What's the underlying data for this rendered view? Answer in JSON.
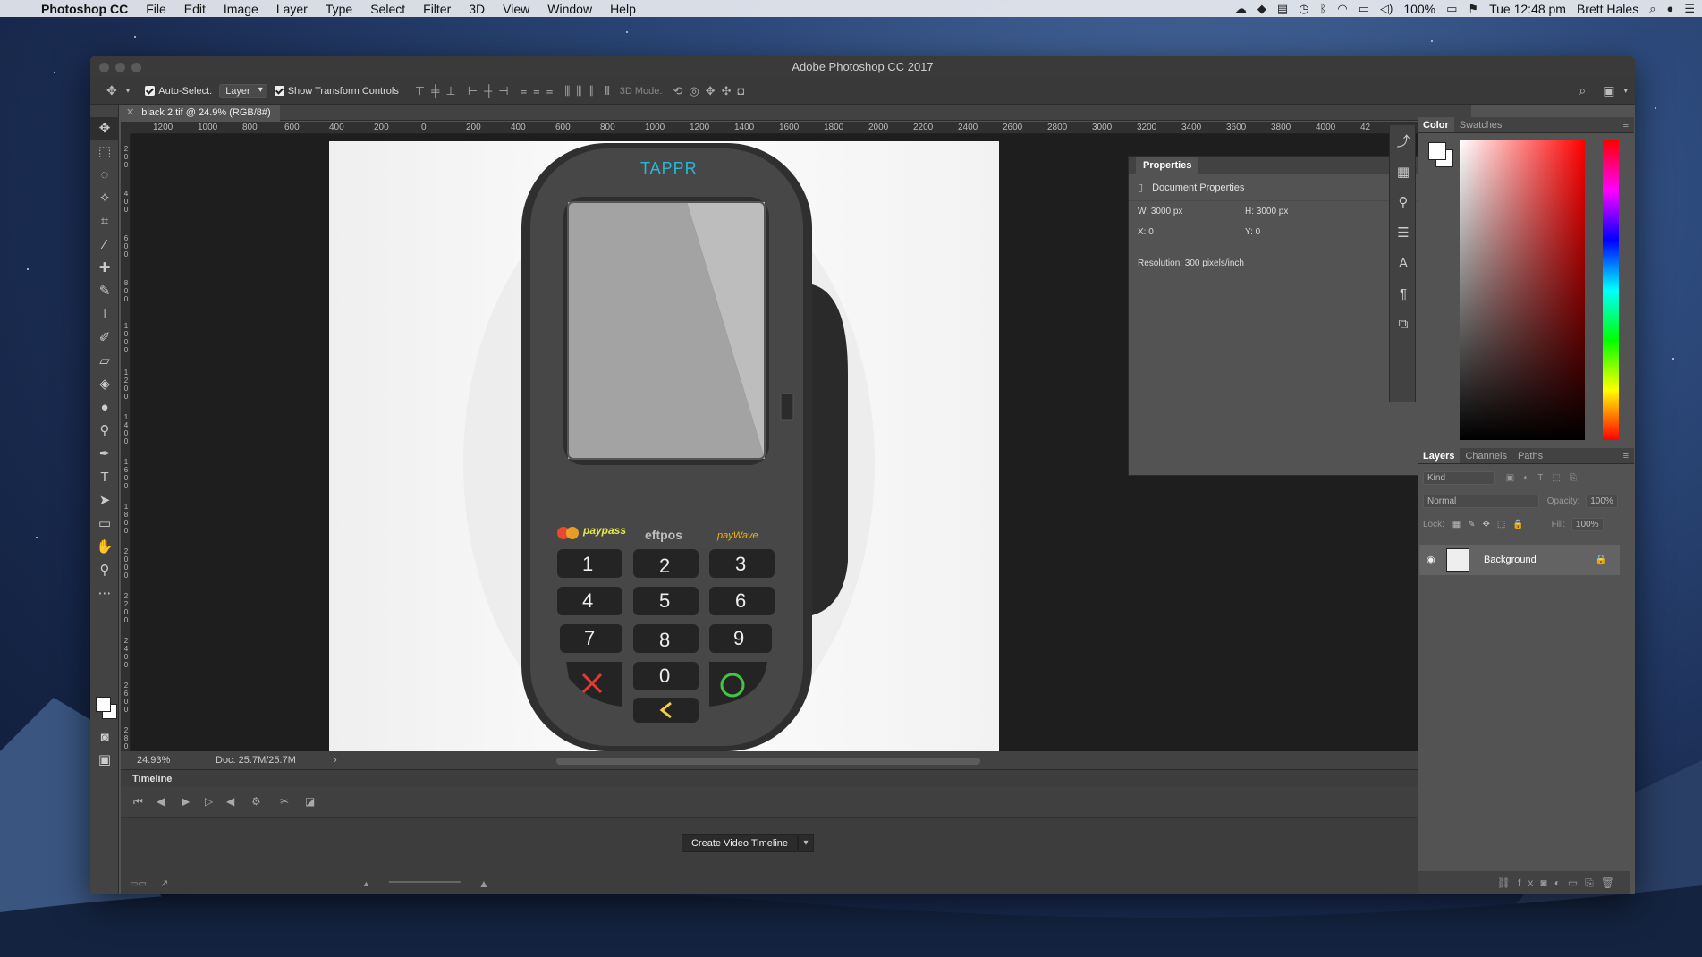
{
  "menubar": {
    "app_name": "Photoshop CC",
    "items": [
      "File",
      "Edit",
      "Image",
      "Layer",
      "Type",
      "Select",
      "Filter",
      "3D",
      "View",
      "Window",
      "Help"
    ],
    "battery": "100%",
    "clock": "Tue 12:48 pm",
    "user": "Brett Hales"
  },
  "window": {
    "title": "Adobe Photoshop CC 2017"
  },
  "options_bar": {
    "auto_select_label": "Auto-Select:",
    "auto_select_value": "Layer",
    "transform_label": "Show Transform Controls",
    "mode_label": "3D Mode:"
  },
  "doc_tab": {
    "title": "black 2.tif @ 24.9% (RGB/8#)"
  },
  "rulers": {
    "h_ticks": [
      "1200",
      "1000",
      "800",
      "600",
      "400",
      "200",
      "0",
      "200",
      "400",
      "600",
      "800",
      "1000",
      "1200",
      "1400",
      "1600",
      "1800",
      "2000",
      "2200",
      "2400",
      "2600",
      "2800",
      "3000",
      "3200",
      "3400",
      "3600",
      "3800",
      "4000",
      "42"
    ],
    "v_ticks": [
      "200",
      "400",
      "600",
      "800",
      "1000",
      "1200",
      "1400",
      "1600",
      "1800",
      "2000",
      "2200",
      "2400",
      "2600",
      "2800",
      "2"
    ]
  },
  "device": {
    "brand": "TAPPR",
    "paypass_label": "paypass",
    "eftpos_label": "eftpos",
    "paywave_label": "payWave",
    "keys": [
      "1",
      "2",
      "3",
      "4",
      "5",
      "6",
      "7",
      "8",
      "9",
      "0"
    ]
  },
  "status": {
    "zoom": "24.93%",
    "doc_size": "Doc: 25.7M/25.7M"
  },
  "timeline": {
    "label": "Timeline",
    "create_button": "Create Video Timeline"
  },
  "properties": {
    "title": "Properties",
    "section": "Document Properties",
    "width": "W:  3000 px",
    "height": "H:  3000 px",
    "x": "X:  0",
    "y": "Y:  0",
    "resolution": "Resolution: 300 pixels/inch"
  },
  "color_panel": {
    "tabs": [
      "Color",
      "Swatches"
    ]
  },
  "layers_panel": {
    "tabs": [
      "Layers",
      "Channels",
      "Paths"
    ],
    "filter_placeholder": "Kind",
    "blend_mode": "Normal",
    "opacity_label": "Opacity:",
    "opacity_value": "100%",
    "lock_label": "Lock:",
    "fill_label": "Fill:",
    "fill_value": "100%",
    "layer_name": "Background"
  }
}
